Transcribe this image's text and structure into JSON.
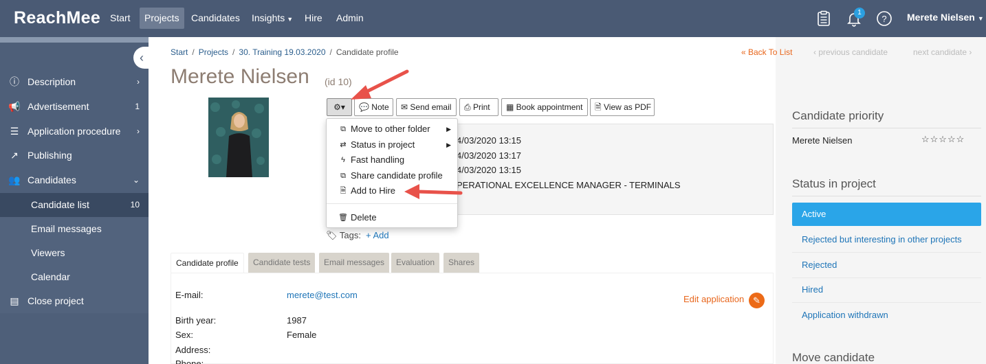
{
  "app": {
    "logo": "ReachMee"
  },
  "topnav": {
    "items": [
      {
        "label": "Start"
      },
      {
        "label": "Projects"
      },
      {
        "label": "Candidates"
      },
      {
        "label": "Insights"
      },
      {
        "label": "Hire"
      },
      {
        "label": "Admin"
      }
    ],
    "notification_count": "1",
    "user": "Merete Nielsen"
  },
  "sidebar": {
    "items": [
      {
        "label": "Description",
        "icon": "info-icon"
      },
      {
        "label": "Advertisement",
        "icon": "megaphone-icon",
        "count": "1"
      },
      {
        "label": "Application procedure",
        "icon": "list-icon"
      },
      {
        "label": "Publishing",
        "icon": "share-icon"
      },
      {
        "label": "Candidates",
        "icon": "users-icon"
      },
      {
        "label": "Candidate list",
        "count": "10"
      },
      {
        "label": "Email messages"
      },
      {
        "label": "Viewers"
      },
      {
        "label": "Calendar"
      },
      {
        "label": "Close project",
        "icon": "archive-icon"
      }
    ]
  },
  "breadcrumb": {
    "items": [
      "Start",
      "Projects",
      "30. Training 19.03.2020"
    ],
    "current": "Candidate profile"
  },
  "pager": {
    "back": "« Back To List",
    "prev": "‹ previous candidate",
    "next": "next candidate ›"
  },
  "candidate": {
    "name": "Merete Nielsen",
    "id": "(id 10)"
  },
  "toolbar": {
    "note": "Note",
    "send_email": "Send email",
    "print": "Print",
    "book": "Book appointment",
    "pdf": "View as PDF"
  },
  "info_lines": [
    "4/03/2020 13:15",
    "4/03/2020 13:17",
    "4/03/2020 13:15",
    "PERATIONAL EXCELLENCE MANAGER - TERMINALS"
  ],
  "menu": {
    "items": [
      {
        "label": "Move to other folder",
        "icon": "external-link-icon"
      },
      {
        "label": "Status in project",
        "icon": "exchange-icon"
      },
      {
        "label": "Fast handling",
        "icon": "bolt-icon"
      },
      {
        "label": "Share candidate profile",
        "icon": "external-link-icon"
      },
      {
        "label": "Add to Hire",
        "icon": "file-icon"
      },
      {
        "label": "Delete",
        "icon": "trash-icon"
      }
    ]
  },
  "tags": {
    "label": "Tags:",
    "add": "+ Add"
  },
  "tabs": [
    "Candidate profile",
    "Candidate tests",
    "Email messages",
    "Evaluation",
    "Shares"
  ],
  "profile": {
    "email_label": "E-mail:",
    "email_value": "merete@test.com",
    "birth_label": "Birth year:",
    "birth_value": "1987",
    "sex_label": "Sex:",
    "sex_value": "Female",
    "address_label": "Address:",
    "phone_label": "Phone:",
    "edit_application": "Edit application"
  },
  "right": {
    "priority_heading": "Candidate priority",
    "priority_name": "Merete Nielsen",
    "stars": "☆☆☆☆☆",
    "status_heading": "Status in project",
    "statuses": [
      "Active",
      "Rejected but interesting in other projects",
      "Rejected",
      "Hired",
      "Application withdrawn"
    ],
    "move_heading": "Move candidate"
  },
  "colors": {
    "nav": "#4a5a74",
    "sidebar": "#4e5f79",
    "accent_orange": "#e8661c",
    "active_status": "#2aa5e8",
    "annotation_arrow": "#e8524a"
  }
}
